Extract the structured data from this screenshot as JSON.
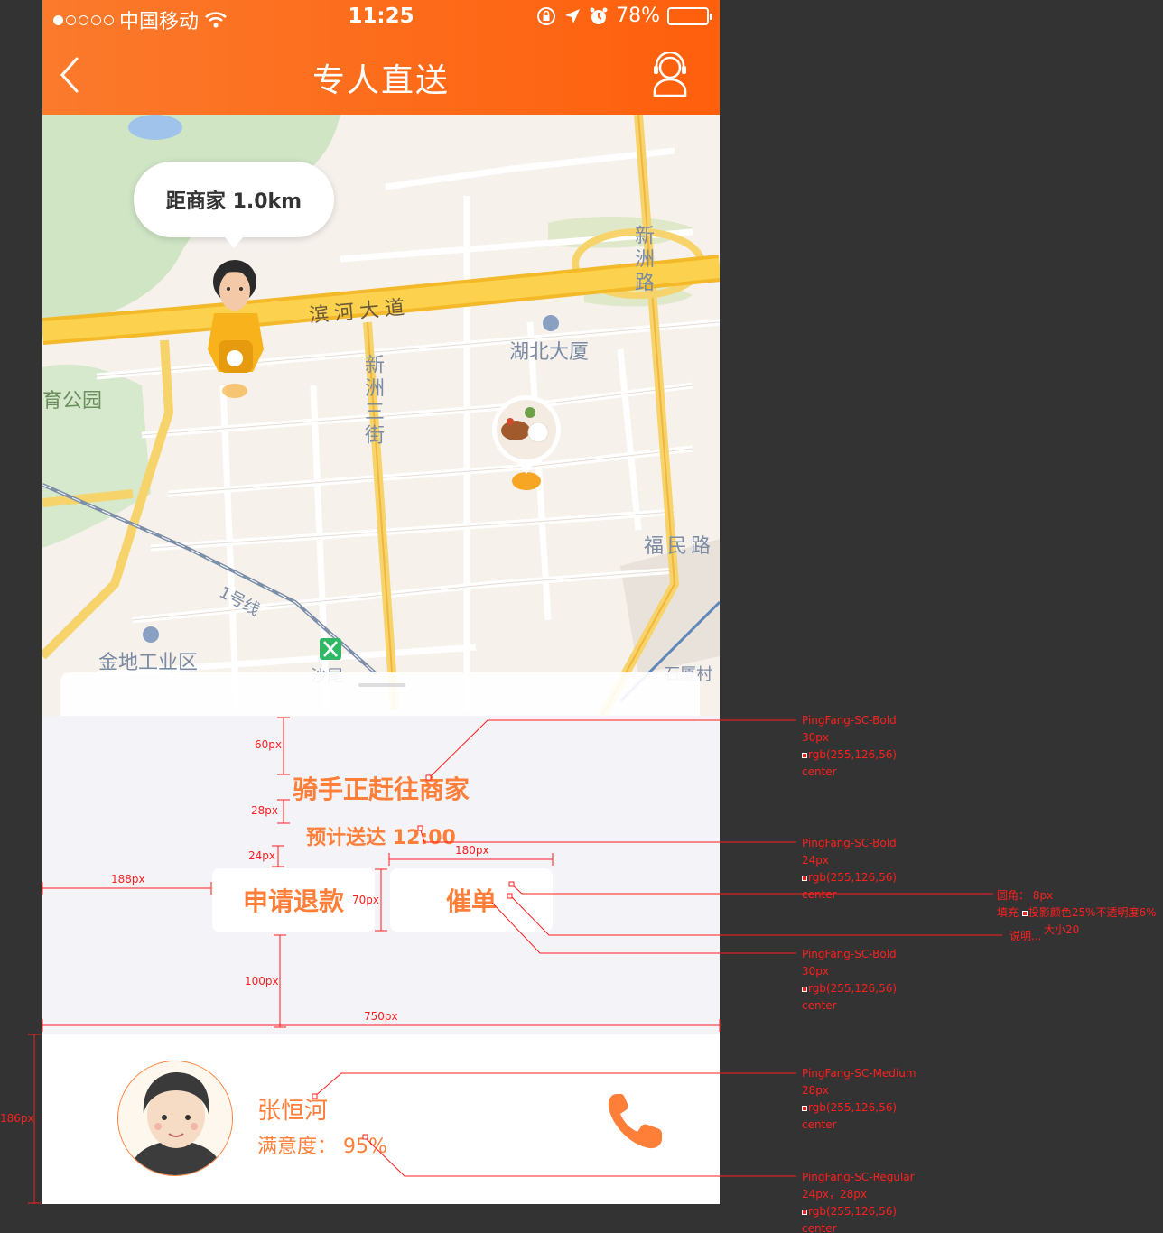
{
  "statusbar": {
    "carrier": "中国移动",
    "time": "11:25",
    "battery": "78%",
    "battery_level": 0.78
  },
  "navbar": {
    "title": "专人直送",
    "back_icon": "chevron-left-icon",
    "service_icon": "customer-service-icon"
  },
  "map": {
    "distance_bubble": "距商家 1.0km",
    "labels": {
      "road_binhe": "滨河大道",
      "road_xinzhou": "新洲路",
      "road_xinzhou3": "新洲三街",
      "road_fumin": "福民路",
      "building_hubei": "湖北大厦",
      "park": "育公园",
      "metro_line": "1号线",
      "jindi": "金地工业区",
      "shawei": "沙尾",
      "shixia": "石厦村"
    }
  },
  "order_status": {
    "title": "骑手正赶往商家",
    "eta": "预计送达 12:00",
    "refund_button": "申请退款",
    "urge_button": "催单"
  },
  "rider": {
    "name": "张恒河",
    "rating": "满意度： 95%",
    "call_icon": "phone-icon"
  },
  "annotations": {
    "dims": {
      "d60": "60px",
      "d28": "28px",
      "d24": "24px",
      "d180": "180px",
      "d188": "188px",
      "d70": "70px",
      "d100": "100px",
      "d750": "750px",
      "d186": "186px"
    },
    "specs": [
      {
        "font": "PingFang-SC-Bold",
        "size": "30px",
        "color": "rgb(255,126,56)",
        "align": "center"
      },
      {
        "font": "PingFang-SC-Bold",
        "size": "24px",
        "color": "rgb(255,126,56)",
        "align": "center"
      },
      {
        "font": "PingFang-SC-Bold",
        "size": "30px",
        "color": "rgb(255,126,56)",
        "align": "center"
      },
      {
        "font": "PingFang-SC-Medium",
        "size": "28px",
        "color": "rgb(255,126,56)",
        "align": "center"
      },
      {
        "font": "PingFang-SC-Regular",
        "size": "24px，28px",
        "color": "rgb(255,126,56)",
        "align": "center"
      }
    ],
    "button_note": {
      "radius": "圆角： 8px",
      "fill": "填充",
      "shadow": "投影颜色25%不透明度6%",
      "size": "大小20",
      "note": "说明..."
    }
  },
  "colors": {
    "accent": "#ff7e38",
    "nav_start": "#fb7a2c",
    "nav_end": "#fe5f0c",
    "panel_bg": "#f3f3f8",
    "annotation": "#ff1e1e",
    "artboard_bg": "#333333"
  }
}
